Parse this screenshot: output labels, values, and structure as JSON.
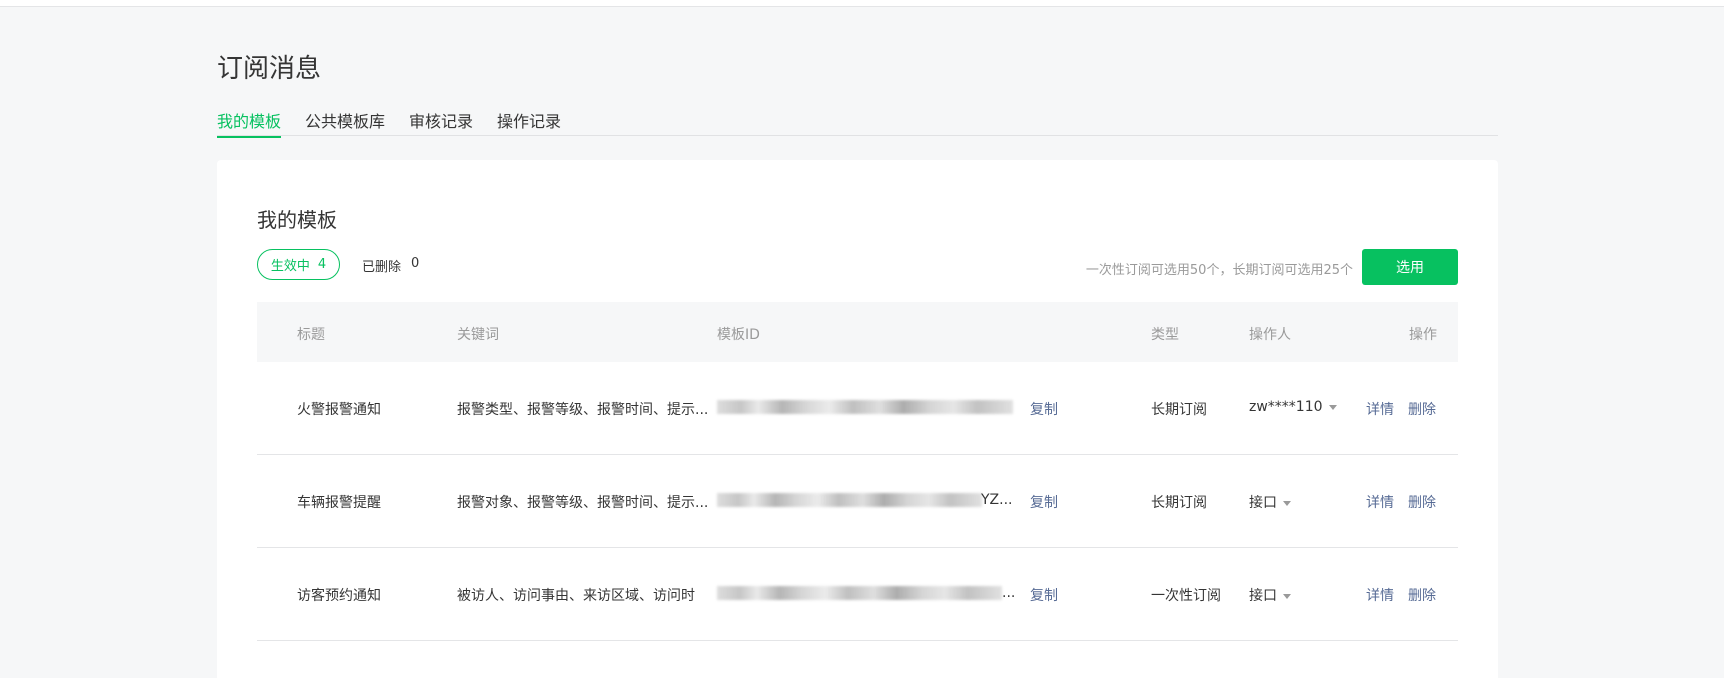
{
  "page": {
    "title": "订阅消息"
  },
  "tabs": [
    {
      "label": "我的模板",
      "active": true
    },
    {
      "label": "公共模板库",
      "active": false
    },
    {
      "label": "审核记录",
      "active": false
    },
    {
      "label": "操作记录",
      "active": false
    }
  ],
  "card": {
    "title": "我的模板",
    "filter_active": {
      "label": "生效中",
      "count": "4"
    },
    "filter_deleted": {
      "label": "已删除",
      "count": "0"
    },
    "limit_hint": "一次性订阅可选用50个，长期订阅可选用25个",
    "select_button": "选用"
  },
  "table": {
    "headers": {
      "title": "标题",
      "keywords": "关键词",
      "template_id": "模板ID",
      "type": "类型",
      "operator": "操作人",
      "actions": "操作"
    },
    "rows": [
      {
        "title": "火警报警通知",
        "keywords": "报警类型、报警等级、报警时间、提示...",
        "template_id_tail": "",
        "copy": "复制",
        "type": "长期订阅",
        "operator": "zw****110",
        "detail": "详情",
        "delete": "删除"
      },
      {
        "title": "车辆报警提醒",
        "keywords": "报警对象、报警等级、报警时间、提示...",
        "template_id_tail": "YZ...",
        "copy": "复制",
        "type": "长期订阅",
        "operator": "接口",
        "detail": "详情",
        "delete": "删除"
      },
      {
        "title": "访客预约通知",
        "keywords": "被访人、访问事由、来访区域、访问时",
        "template_id_tail": "...",
        "copy": "复制",
        "type": "一次性订阅",
        "operator": "接口",
        "detail": "详情",
        "delete": "删除"
      }
    ]
  },
  "colors": {
    "accent": "#07c160",
    "link": "#576b95",
    "muted": "#9a9a9a"
  }
}
